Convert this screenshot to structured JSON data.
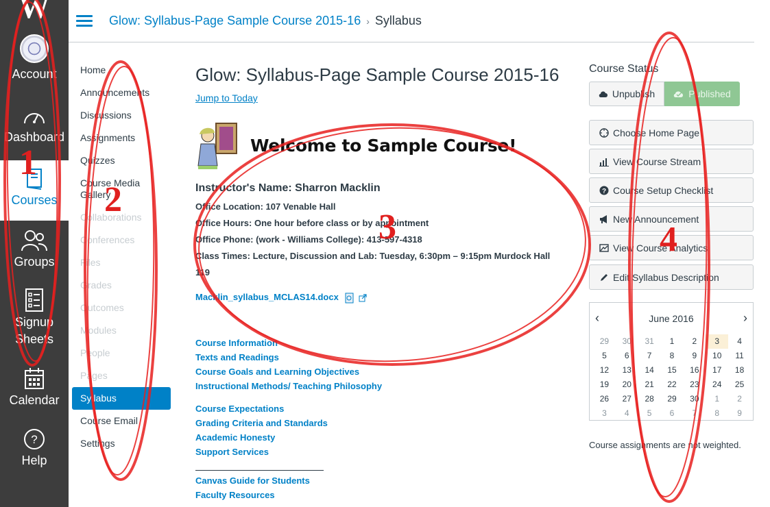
{
  "global_nav": {
    "logo": "W",
    "items": [
      {
        "label": "Account",
        "icon": "account-avatar"
      },
      {
        "label": "Dashboard",
        "icon": "dashboard-icon"
      },
      {
        "label": "Courses",
        "icon": "courses-icon"
      },
      {
        "label": "Groups",
        "icon": "groups-icon"
      },
      {
        "label": "Signup Sheets",
        "icon": "signup-sheets-icon"
      },
      {
        "label": "Calendar",
        "icon": "calendar-icon"
      },
      {
        "label": "Help",
        "icon": "help-icon"
      }
    ]
  },
  "header": {
    "breadcrumb_course": "Glow: Syllabus-Page Sample Course 2015-16",
    "separator": "›",
    "breadcrumb_current": "Syllabus"
  },
  "course_nav": {
    "items": [
      {
        "label": "Home"
      },
      {
        "label": "Announcements"
      },
      {
        "label": "Discussions"
      },
      {
        "label": "Assignments"
      },
      {
        "label": "Quizzes"
      },
      {
        "label": "Course Media Gallery"
      },
      {
        "label": "Collaborations"
      },
      {
        "label": "Conferences"
      },
      {
        "label": "Files"
      },
      {
        "label": "Grades"
      },
      {
        "label": "Outcomes"
      },
      {
        "label": "Modules"
      },
      {
        "label": "People"
      },
      {
        "label": "Pages"
      },
      {
        "label": "Syllabus"
      },
      {
        "label": "Course Email"
      },
      {
        "label": "Settings"
      }
    ]
  },
  "main": {
    "title": "Glow: Syllabus-Page Sample Course 2015-16",
    "jump_to_today": "Jump to Today",
    "welcome": "Welcome to Sample Course!",
    "instructor": "Instructor's Name: Sharron Macklin",
    "office_location": "Office Location: 107 Venable Hall",
    "office_hours": "Office Hours: One hour before class or by appointment",
    "office_phone": "Office Phone: (work - Williams College): 413-597-4318",
    "class_times": "Class Times: Lecture, Discussion and Lab: Tuesday, 6:30pm – 9:15pm Murdock Hall 119",
    "file_link": "Macklin_syllabus_MCLAS14.docx",
    "links_group1": [
      "Course Information",
      "Texts and Readings",
      "Course Goals and Learning Objectives",
      "Instructional Methods/ Teaching Philosophy"
    ],
    "links_group2": [
      "Course Expectations",
      "Grading Criteria and Standards",
      "Academic Honesty",
      "Support Services"
    ],
    "links_group3": [
      "Canvas Guide for Students",
      "Faculty Resources"
    ]
  },
  "sidebar": {
    "course_status_title": "Course Status",
    "unpublish": "Unpublish",
    "published": "Published",
    "buttons": [
      {
        "label": "Choose Home Page",
        "icon": "home-page-icon"
      },
      {
        "label": "View Course Stream",
        "icon": "stream-chart-icon"
      },
      {
        "label": "Course Setup Checklist",
        "icon": "question-icon"
      },
      {
        "label": "New Announcement",
        "icon": "megaphone-icon"
      },
      {
        "label": "View Course Analytics",
        "icon": "analytics-icon"
      },
      {
        "label": "Edit Syllabus Description",
        "icon": "pencil-icon"
      }
    ],
    "calendar": {
      "month": "June 2016",
      "prev": "‹",
      "next": "›",
      "weeks": [
        [
          "29",
          "30",
          "31",
          "1",
          "2",
          "3",
          "4"
        ],
        [
          "5",
          "6",
          "7",
          "8",
          "9",
          "10",
          "11"
        ],
        [
          "12",
          "13",
          "14",
          "15",
          "16",
          "17",
          "18"
        ],
        [
          "19",
          "20",
          "21",
          "22",
          "23",
          "24",
          "25"
        ],
        [
          "26",
          "27",
          "28",
          "29",
          "30",
          "1",
          "2"
        ],
        [
          "3",
          "4",
          "5",
          "6",
          "7",
          "8",
          "9"
        ]
      ]
    },
    "weight_note": "Course assignments are not weighted."
  },
  "annotations": {
    "numbers": [
      "1",
      "2",
      "3",
      "4"
    ],
    "color": "#e0201f"
  },
  "colors": {
    "brand_blue": "#0081c7",
    "nav_bg": "#3d3d3d",
    "published_green": "#8fc794"
  }
}
